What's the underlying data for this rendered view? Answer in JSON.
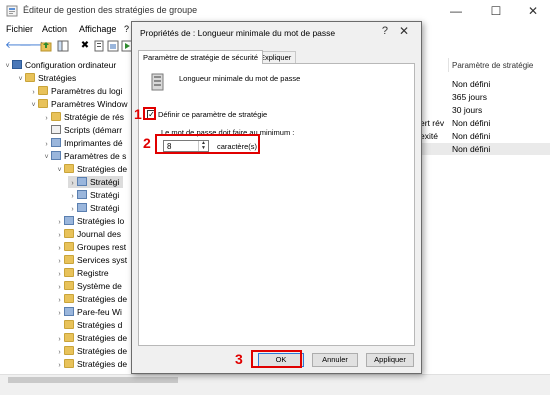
{
  "window": {
    "title": "Éditeur de gestion des stratégies de groupe",
    "minimize": "—",
    "maximize": "☐",
    "close": "✕"
  },
  "menu": [
    "Fichier",
    "Action",
    "Affichage",
    "?"
  ],
  "tree": [
    {
      "label": "Configuration ordinateur",
      "exp": "˅",
      "icon": "computer-icon"
    },
    {
      "label": "Stratégies",
      "exp": "˅",
      "icon": "folder-icon"
    },
    {
      "label": "Paramètres du logi",
      "exp": "›",
      "icon": "folder-icon"
    },
    {
      "label": "Paramètres Window",
      "exp": "˅",
      "icon": "folder-icon"
    },
    {
      "label": "Stratégie de rés",
      "exp": "›",
      "icon": "folder-icon"
    },
    {
      "label": "Scripts (démarr",
      "exp": "",
      "icon": "document-icon"
    },
    {
      "label": "Imprimantes dé",
      "exp": "›",
      "icon": "printer-icon"
    },
    {
      "label": "Paramètres de s",
      "exp": "˅",
      "icon": "security-icon"
    },
    {
      "label": "Stratégies de",
      "exp": "˅",
      "icon": "folder-icon"
    },
    {
      "label": "Stratégi",
      "exp": "›",
      "icon": "folder-icon"
    },
    {
      "label": "Stratégi",
      "exp": "›",
      "icon": "folder-icon"
    },
    {
      "label": "Stratégi",
      "exp": "›",
      "icon": "folder-icon"
    },
    {
      "label": "Stratégies lo",
      "exp": "›",
      "icon": "folder-icon"
    },
    {
      "label": "Journal des",
      "exp": "›",
      "icon": "folder-icon"
    },
    {
      "label": "Groupes rest",
      "exp": "›",
      "icon": "folder-icon"
    },
    {
      "label": "Services syst",
      "exp": "›",
      "icon": "folder-icon"
    },
    {
      "label": "Registre",
      "exp": "›",
      "icon": "folder-icon"
    },
    {
      "label": "Système de",
      "exp": "›",
      "icon": "folder-icon"
    },
    {
      "label": "Stratégies de",
      "exp": "›",
      "icon": "folder-icon"
    },
    {
      "label": "Pare-feu Wi",
      "exp": "›",
      "icon": "folder-icon"
    },
    {
      "label": "Stratégies d",
      "exp": "",
      "icon": "folder-icon"
    },
    {
      "label": "Stratégies de",
      "exp": "›",
      "icon": "folder-icon"
    },
    {
      "label": "Stratégies de",
      "exp": "›",
      "icon": "folder-icon"
    },
    {
      "label": "Stratégies de",
      "exp": "›",
      "icon": "folder-icon"
    }
  ],
  "right_pane": {
    "column_header": "Paramètre de stratégie",
    "values": [
      "Non défini",
      "365 jours",
      "30 jours",
      "Non défini",
      "Non défini",
      "Non défini"
    ],
    "partial_labels": [
      "ert rév",
      "exité"
    ]
  },
  "dialog": {
    "title": "Propriétés de : Longueur minimale du mot de passe",
    "help": "?",
    "close": "✕",
    "tabs": [
      "Paramètre de stratégie de sécurité",
      "Expliquer"
    ],
    "policy_name": "Longueur minimale du mot de passe",
    "checkbox_label": "Définir ce paramètre de stratégie",
    "checkbox_checked": true,
    "min_label": "Le mot de passe doit faire au minimum :",
    "min_value": "8",
    "unit_label": "caractère(s)",
    "buttons": {
      "ok": "OK",
      "cancel": "Annuler",
      "apply": "Appliquer"
    }
  },
  "annotations": {
    "one": "1",
    "two": "2",
    "three": "3",
    "color": "#e00000"
  }
}
